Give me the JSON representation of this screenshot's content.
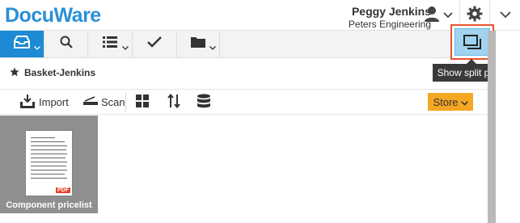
{
  "header": {
    "logo_text": "DocuWare",
    "user_name": "Peggy Jenkins",
    "user_company": "Peters Engineering",
    "icons": [
      "user-icon",
      "chevron-down-icon",
      "gear-icon",
      "chevron-down-icon"
    ]
  },
  "toolbar": {
    "buttons": [
      {
        "name": "basket-tray",
        "icon": "tray-icon",
        "active": true
      },
      {
        "name": "search",
        "icon": "search-icon"
      },
      {
        "name": "list",
        "icon": "list-icon"
      },
      {
        "name": "tasks",
        "icon": "checkmark-icon"
      },
      {
        "name": "folder",
        "icon": "folder-icon"
      }
    ],
    "split_pane_tooltip": "Show split pane"
  },
  "basket": {
    "title": "Basket-Jenkins"
  },
  "actions": {
    "import_label": "Import",
    "scan_label": "Scan",
    "store_label": "Store"
  },
  "documents": [
    {
      "label": "Component pricelist",
      "badge": "PDF"
    }
  ],
  "colors": {
    "accent": "#1c8ad4",
    "store": "#f5a623",
    "highlight": "#e8532b",
    "tile": "#8f8f8f"
  }
}
